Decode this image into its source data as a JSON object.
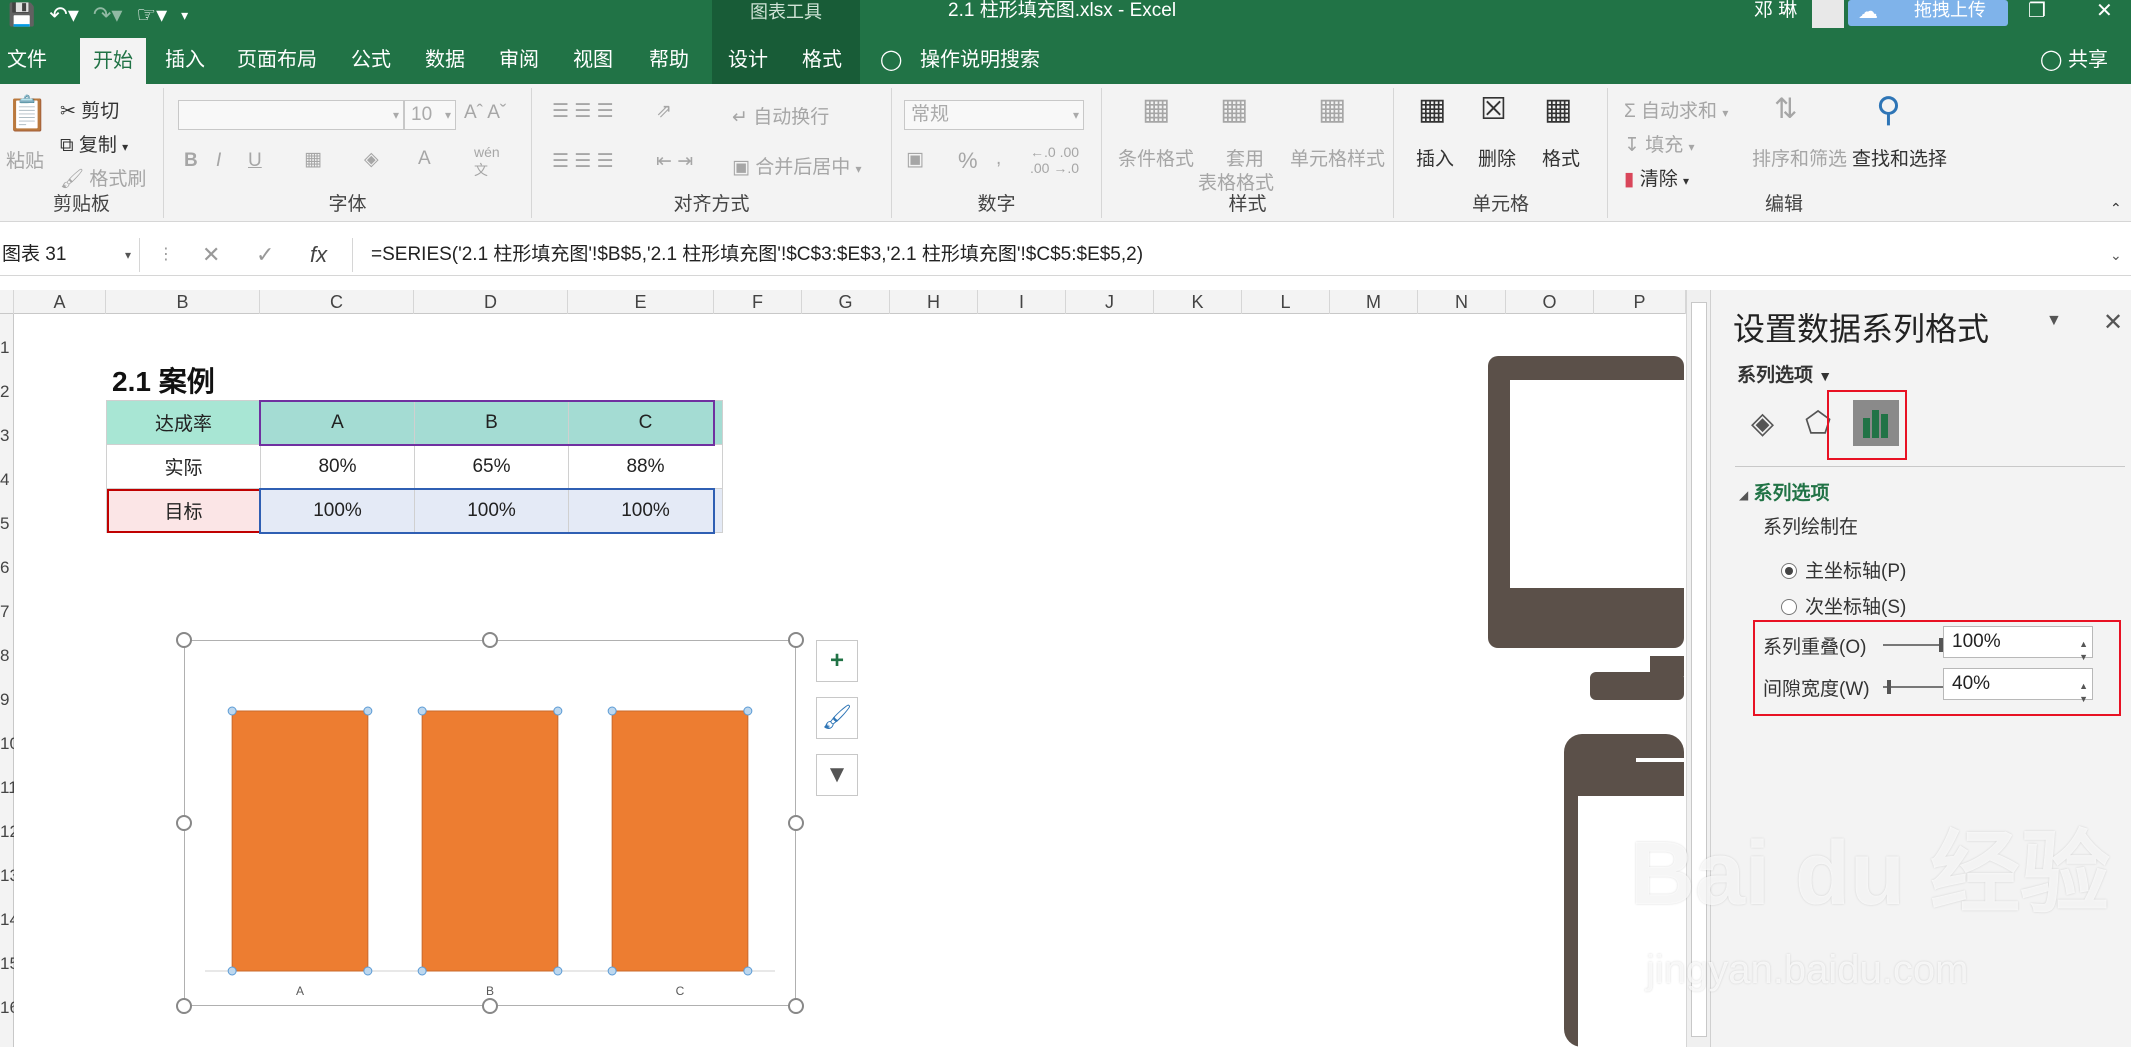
{
  "app": {
    "context_tools_label": "图表工具",
    "document_title": "2.1 柱形填充图.xlsx  -  Excel",
    "user_name": "邓 琳",
    "upload_button": "拖拽上传",
    "accent_color": "#217346"
  },
  "tabs": [
    {
      "label": "文件"
    },
    {
      "label": "开始"
    },
    {
      "label": "插入"
    },
    {
      "label": "页面布局"
    },
    {
      "label": "公式"
    },
    {
      "label": "数据"
    },
    {
      "label": "审阅"
    },
    {
      "label": "视图"
    },
    {
      "label": "帮助"
    },
    {
      "label": "设计"
    },
    {
      "label": "格式"
    }
  ],
  "tell_me": "操作说明搜索",
  "share": "共享",
  "ribbon": {
    "clipboard": {
      "paste": "粘贴",
      "cut": "剪切",
      "copy": "复制",
      "format_painter": "格式刷",
      "label": "剪贴板"
    },
    "font": {
      "font_size": "10",
      "label": "字体"
    },
    "alignment": {
      "wrap": "自动换行",
      "merge": "合并后居中",
      "label": "对齐方式"
    },
    "number": {
      "format": "常规",
      "label": "数字"
    },
    "styles": {
      "conditional": "条件格式",
      "table_format_1": "套用",
      "table_format_2": "表格格式",
      "cell_styles": "单元格样式",
      "label": "样式"
    },
    "cells": {
      "insert": "插入",
      "delete": "删除",
      "format": "格式",
      "label": "单元格"
    },
    "editing": {
      "autosum": "自动求和",
      "fill": "填充",
      "clear": "清除",
      "sort_filter": "排序和筛选",
      "find_select": "查找和选择",
      "label": "编辑"
    }
  },
  "formula_bar": {
    "name_box": "图表 31",
    "formula": "=SERIES('2.1 柱形填充图'!$B$5,'2.1 柱形填充图'!$C$3:$E$3,'2.1 柱形填充图'!$C$5:$E$5,2)"
  },
  "columns": [
    "A",
    "B",
    "C",
    "D",
    "E",
    "F",
    "G",
    "H",
    "I",
    "J",
    "K",
    "L",
    "M",
    "N",
    "O",
    "P"
  ],
  "rows": [
    "1",
    "2",
    "3",
    "4",
    "5",
    "6",
    "7",
    "8",
    "9",
    "10",
    "11",
    "12",
    "13",
    "14",
    "15",
    "16"
  ],
  "sheet": {
    "title": "2.1 案例",
    "table": {
      "header": [
        "达成率",
        "A",
        "B",
        "C"
      ],
      "actual": [
        "实际",
        "80%",
        "65%",
        "88%"
      ],
      "target": [
        "目标",
        "100%",
        "100%",
        "100%"
      ]
    }
  },
  "chart_data": {
    "type": "bar",
    "categories": [
      "A",
      "B",
      "C"
    ],
    "series": [
      {
        "values": [
          100,
          100,
          100
        ]
      }
    ],
    "ylim": [
      0,
      100
    ],
    "bar_color": "#ed7d31",
    "grid": false
  },
  "pane": {
    "title": "设置数据系列格式",
    "options_header": "系列选项",
    "section": "系列选项",
    "plot_on": "系列绘制在",
    "primary_axis": "主坐标轴(P)",
    "secondary_axis": "次坐标轴(S)",
    "overlap_label": "系列重叠(O)",
    "overlap_value": "100%",
    "overlap_fraction": 1.0,
    "gap_label": "间隙宽度(W)",
    "gap_value": "40%",
    "gap_fraction": 0.08
  },
  "watermark": {
    "main": "Bai du 经验",
    "sub": "jingyan.baidu.com"
  }
}
